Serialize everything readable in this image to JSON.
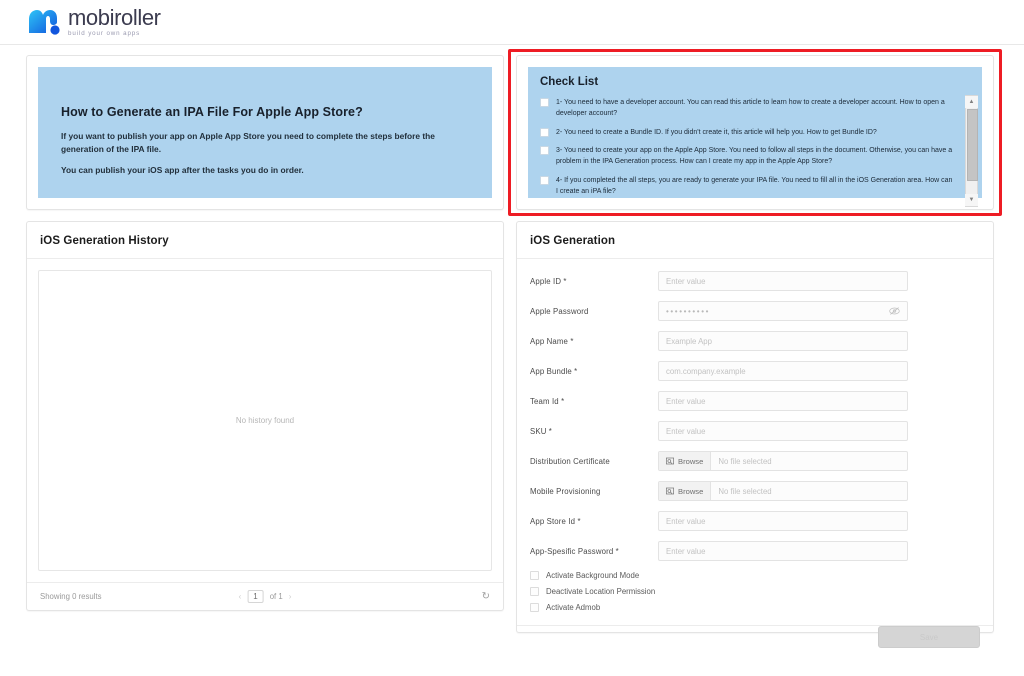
{
  "header": {
    "logo_word": "mobiroller",
    "logo_tagline": "build your own apps"
  },
  "info_panel": {
    "title": "How to Generate an IPA File For Apple App Store?",
    "paragraph1": "If you want to publish your app on Apple App Store you need to complete the steps before the generation of the IPA file.",
    "paragraph2": "You can publish your iOS app after the tasks you do in order.",
    "background_color": "#aed3ee"
  },
  "checklist": {
    "title": "Check List",
    "highlight_color": "#ee1c24",
    "items": [
      {
        "text": "1- You need to have a developer account. You can read this article to learn how to create a developer account. How to open a developer account?"
      },
      {
        "text": "2- You need to create a Bundle ID. If you didn't create it, this article will help you. How to get Bundle ID?"
      },
      {
        "text": "3- You need to create your app on the Apple App Store. You need to follow all steps in the document. Otherwise, you can have a problem in the IPA Generation process. How can I create my app in the Apple App Store?"
      },
      {
        "text": "4- If you completed the all steps, you are ready to generate your IPA file. You need to fill all in the iOS Generation area. How can I create an iPA file?"
      }
    ]
  },
  "history": {
    "title": "iOS Generation History",
    "empty_text": "No history found",
    "footer": {
      "results_text": "Showing 0 results",
      "page_value": "1",
      "of_text": "of 1",
      "prev_icon": "chevron-left-icon",
      "next_icon": "chevron-right-icon",
      "refresh_icon": "refresh-icon"
    }
  },
  "generation_form": {
    "title": "iOS Generation",
    "fields": [
      {
        "label": "Apple ID *",
        "placeholder": "Enter value",
        "type": "text"
      },
      {
        "label": "Apple Password",
        "placeholder": "••••••••••",
        "type": "password"
      },
      {
        "label": "App Name *",
        "placeholder": "Example App",
        "type": "text"
      },
      {
        "label": "App Bundle *",
        "placeholder": "com.company.example",
        "type": "text"
      },
      {
        "label": "Team Id *",
        "placeholder": "Enter value",
        "type": "text"
      },
      {
        "label": "SKU *",
        "placeholder": "Enter value",
        "type": "text"
      },
      {
        "label": "Distribution Certificate",
        "browse_label": "Browse",
        "file_status": "No file selected",
        "type": "file"
      },
      {
        "label": "Mobile Provisioning",
        "browse_label": "Browse",
        "file_status": "No file selected",
        "type": "file"
      },
      {
        "label": "App Store Id *",
        "placeholder": "Enter value",
        "type": "text"
      },
      {
        "label": "App-Spesific Password *",
        "placeholder": "Enter value",
        "type": "text"
      }
    ],
    "checkboxes": [
      {
        "label": "Activate Background Mode",
        "checked": false
      },
      {
        "label": "Deactivate Location Permission",
        "checked": false
      },
      {
        "label": "Activate Admob",
        "checked": false
      }
    ],
    "submit_label": "Save"
  }
}
